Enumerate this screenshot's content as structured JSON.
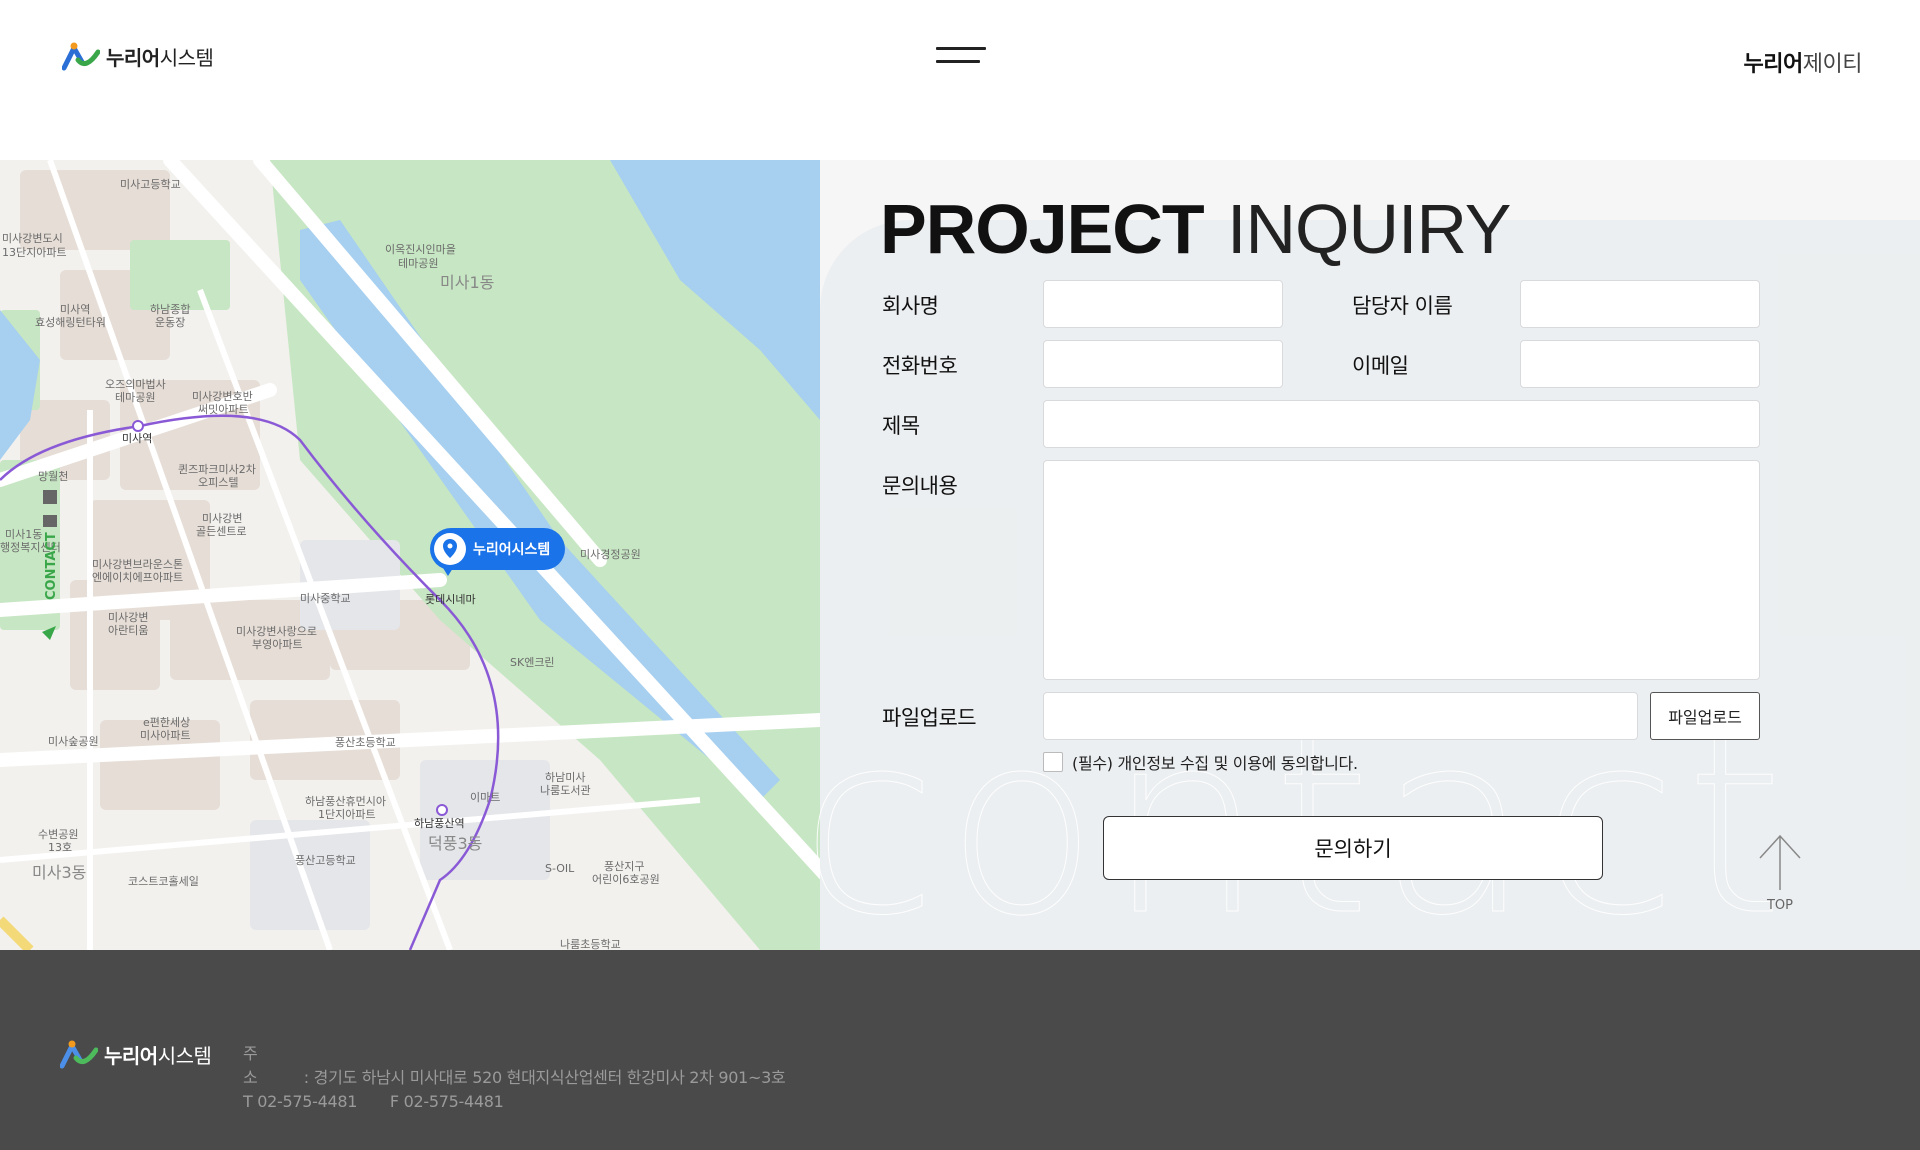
{
  "header": {
    "logo_bold": "누리어",
    "logo_light": "시스템",
    "menu_icon": "hamburger-icon",
    "right_bold": "누리어",
    "right_light": "제이티"
  },
  "map": {
    "pin_label": "누리어시스템",
    "pin_icon": "location-pin-icon",
    "side_tab": "CONTACT",
    "places": [
      "미사고등학교",
      "미사강변도시 13단지아파트",
      "미사역 효성해링턴타워",
      "하남종합 운동장",
      "오즈의마법사 테마공원",
      "미사강변호반 써밋아파트",
      "미사역",
      "퀸즈파크미사2차 오피스텔",
      "미사강변 골든센트로",
      "망월천",
      "미사1동 행정복지센터",
      "미사강변브라운스톤 엔에이치에프아파트",
      "미사중학교",
      "롯데시네마",
      "미사강변 아란티움",
      "미사강변사랑으로 부영아파트",
      "SK엔크린",
      "e편한세상 미사아파트",
      "미사숲공원",
      "풍산초등학교",
      "하남미사 나룸도서관",
      "이마트",
      "하남풍산휴먼시아 1단지아파트",
      "하남풍산역",
      "수변공원 13호",
      "덕풍3동",
      "풍산고등학교",
      "S-OIL",
      "풍산지구 어린이6호공원",
      "미사3동",
      "코스트코홀세일",
      "나룸초등학교",
      "이옥진시인마을 테마공원",
      "미사1동",
      "미사경정공원"
    ]
  },
  "form": {
    "title_bold": "PROJECT",
    "title_thin": "INQUIRY",
    "company_label": "회사명",
    "contact_name_label": "담당자 이름",
    "phone_label": "전화번호",
    "email_label": "이메일",
    "subject_label": "제목",
    "message_label": "문의내용",
    "file_label": "파일업로드",
    "file_button": "파일업로드",
    "agree_text": "(필수) 개인정보 수집 및 이용에 동의합니다.",
    "submit": "문의하기",
    "watermark": "contact",
    "top_label": "TOP"
  },
  "footer": {
    "logo_bold": "누리어",
    "logo_light": "시스템",
    "address_label": "주　　소",
    "address": ": 경기도 하남시 미사대로 520 현대지식산업센터 한강미사 2차 901~3호",
    "tel": "T 02-575-4481",
    "fax": "F 02-575-4481"
  }
}
